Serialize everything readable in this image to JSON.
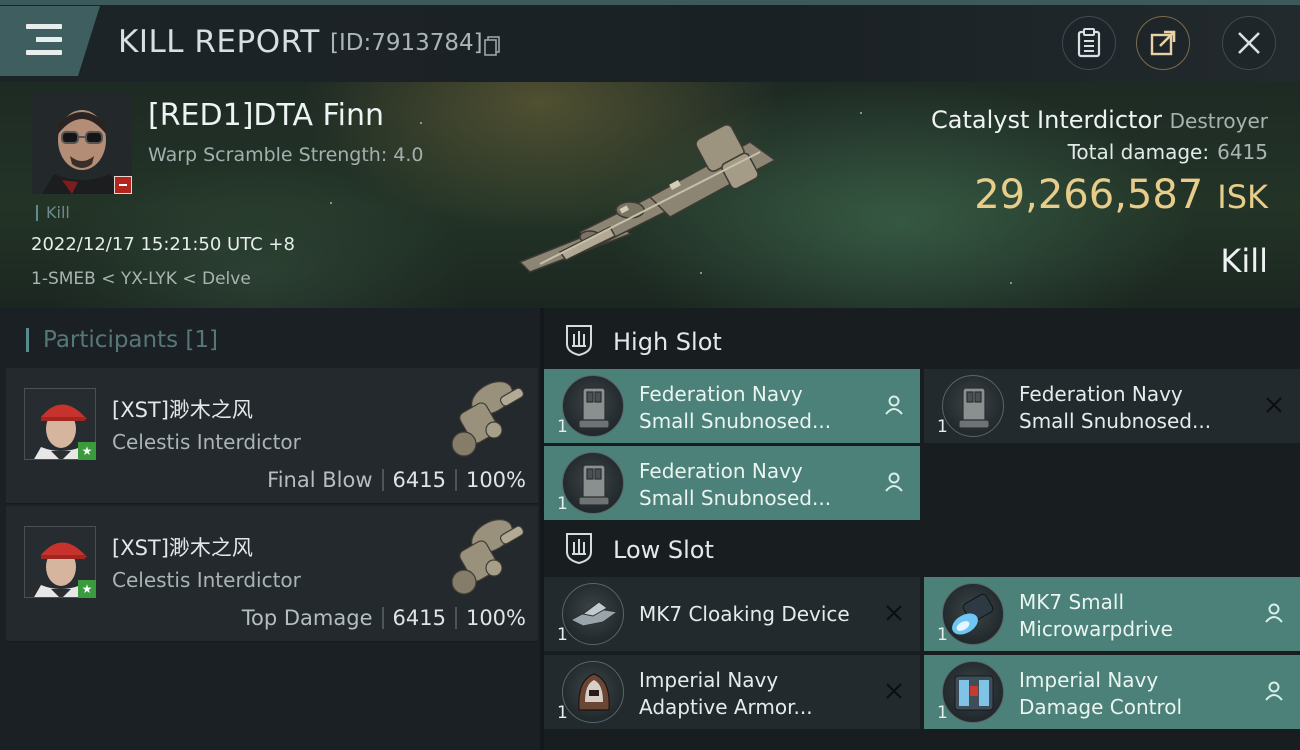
{
  "header": {
    "title": "KILL REPORT",
    "id_label": "[ID:7913784]"
  },
  "victim": {
    "name": "[RED1]DTA Finn",
    "warp_scramble": "Warp Scramble Strength: 4.0",
    "kill_tag": "Kill",
    "datetime": "2022/12/17 15:21:50 UTC +8",
    "location": "1-SMEB < YX-LYK < Delve",
    "ship_name": "Catalyst Interdictor",
    "ship_class": "Destroyer",
    "total_damage_label": "Total damage:",
    "total_damage_value": "6415",
    "isk_value": "29,266,587",
    "isk_unit": "ISK",
    "outcome": "Kill"
  },
  "participants": {
    "header": "Participants [1]",
    "items": [
      {
        "name": "[XST]渺木之风",
        "ship": "Celestis Interdictor",
        "role": "Final Blow",
        "damage": "6415",
        "percent": "100%"
      },
      {
        "name": "[XST]渺木之风",
        "ship": "Celestis Interdictor",
        "role": "Top Damage",
        "damage": "6415",
        "percent": "100%"
      }
    ]
  },
  "fitting": {
    "high_slot": {
      "title": "High Slot",
      "modules": [
        {
          "qty": "1",
          "name_line1": "Federation Navy",
          "name_line2": "Small Snubnosed...",
          "state": "fitted",
          "icon": "launcher-icon"
        },
        {
          "qty": "1",
          "name_line1": "Federation Navy",
          "name_line2": "Small Snubnosed...",
          "state": "destroyed",
          "icon": "launcher-icon"
        },
        {
          "qty": "1",
          "name_line1": "Federation Navy",
          "name_line2": "Small Snubnosed...",
          "state": "fitted",
          "icon": "launcher-icon"
        }
      ]
    },
    "low_slot": {
      "title": "Low Slot",
      "modules": [
        {
          "qty": "1",
          "name_line1": "MK7 Cloaking Device",
          "name_line2": "",
          "state": "destroyed",
          "icon": "cloak-icon"
        },
        {
          "qty": "1",
          "name_line1": "MK7 Small",
          "name_line2": "Microwarpdrive",
          "state": "fitted",
          "icon": "microwarpdrive-icon"
        },
        {
          "qty": "1",
          "name_line1": "Imperial Navy",
          "name_line2": "Adaptive Armor...",
          "state": "destroyed",
          "icon": "armor-hardener-icon"
        },
        {
          "qty": "1",
          "name_line1": "Imperial Navy",
          "name_line2": "Damage Control",
          "state": "fitted",
          "icon": "damage-control-icon"
        }
      ]
    }
  },
  "colors": {
    "accent_teal": "#4b8178",
    "isk_gold": "#e7cc8a",
    "badge_red": "#b3261e",
    "badge_green": "#3a9b3c"
  }
}
